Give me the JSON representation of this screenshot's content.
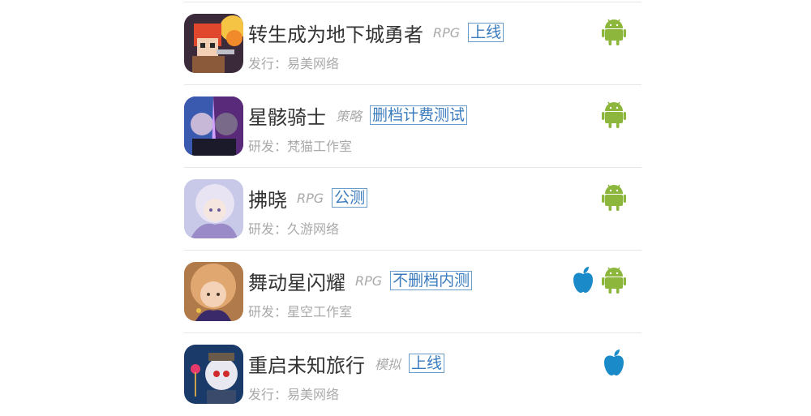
{
  "games": [
    {
      "name": "转生成为地下城勇者",
      "genre": "RPG",
      "status": "上线",
      "publisher": "发行：易美网络",
      "platforms": [
        "android"
      ]
    },
    {
      "name": "星骸骑士",
      "genre": "策略",
      "status": "删档计费测试",
      "publisher": "研发：梵猫工作室",
      "platforms": [
        "android"
      ]
    },
    {
      "name": "拂晓",
      "genre": "RPG",
      "status": "公测",
      "publisher": "研发：久游网络",
      "platforms": [
        "android"
      ]
    },
    {
      "name": "舞动星闪耀",
      "genre": "RPG",
      "status": "不删档内测",
      "publisher": "研发：星空工作室",
      "platforms": [
        "ios",
        "android"
      ]
    },
    {
      "name": "重启未知旅行",
      "genre": "模拟",
      "status": "上线",
      "publisher": "发行：易美网络",
      "platforms": [
        "ios"
      ]
    }
  ],
  "colors": {
    "android": "#8cb63c",
    "ios": "#1a8ac9",
    "status": "#3a7bbd"
  }
}
